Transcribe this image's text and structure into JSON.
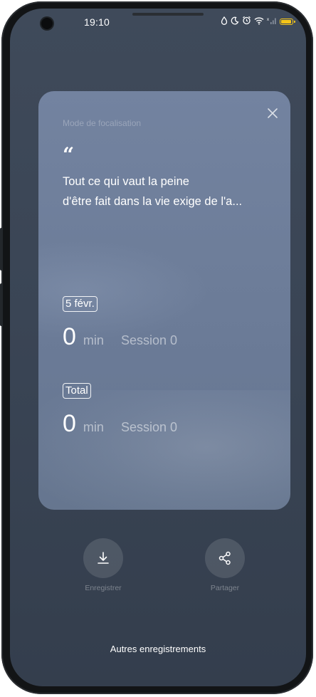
{
  "status_bar": {
    "time": "19:10",
    "icons": [
      "water-drop-icon",
      "moon-icon",
      "alarm-icon",
      "wifi-icon",
      "signal-icon",
      "battery-icon"
    ]
  },
  "card": {
    "mode_title": "Mode de focalisation",
    "quote_mark": "“",
    "quote_line1": "Tout ce qui vaut la peine",
    "quote_line2": "d'être fait dans la vie exige de l'a...",
    "today": {
      "date_tag": "5 févr.",
      "minutes": "0",
      "unit": "min",
      "session": "Session 0"
    },
    "total": {
      "tag": "Total",
      "minutes": "0",
      "unit": "min",
      "session": "Session 0"
    }
  },
  "actions": {
    "save_label": "Enregistrer",
    "share_label": "Partager"
  },
  "footer": {
    "more_records": "Autres enregistrements"
  },
  "colors": {
    "background": "#3a4555",
    "card": "#6f7f9b",
    "battery": "#f5c518"
  }
}
